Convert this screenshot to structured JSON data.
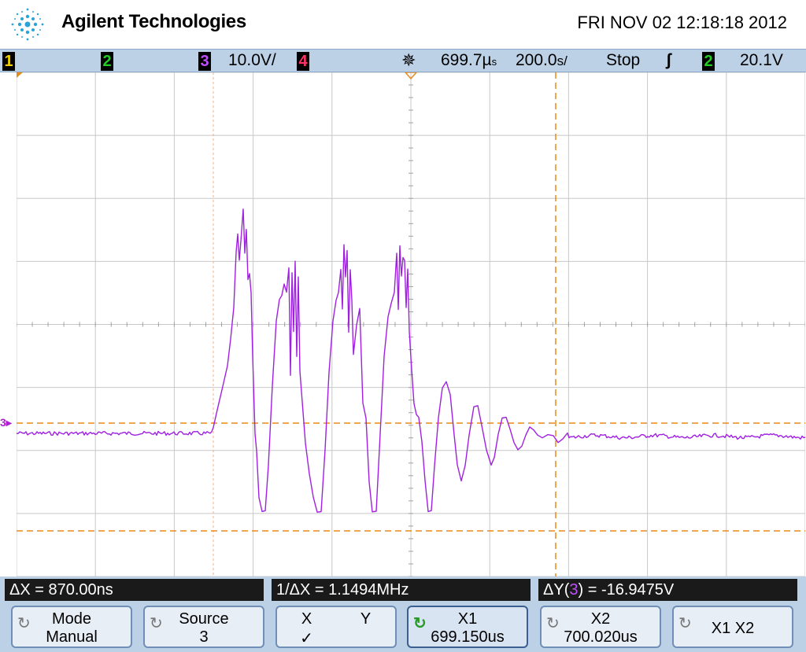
{
  "header": {
    "brand": "Agilent Technologies",
    "datetime": "FRI NOV 02 12:18:18 2012"
  },
  "statusbar": {
    "ch1": "1",
    "ch2": "2",
    "ch3": "3",
    "ch3_scale": "10.0V/",
    "ch4": "4",
    "trigger_icon": "trigger-icon",
    "delay": "699.7µ",
    "delay_unit": "s",
    "timebase": "200.0",
    "timebase_unit": "s/",
    "run_state": "Stop",
    "trigger_edge": "ʃ",
    "trigger_source": "2",
    "trigger_level": "20.1V"
  },
  "screen": {
    "ch3_marker": "3"
  },
  "measurements": {
    "dx": "ΔX = 870.00ns",
    "inv_dx": "1/ΔX = 1.1494MHz",
    "dy_prefix": "ΔY(",
    "dy_ch": "3",
    "dy_suffix": ") = -16.9475V"
  },
  "softkeys": {
    "mode_label": "Mode",
    "mode_value": "Manual",
    "source_label": "Source",
    "source_value": "3",
    "xy_x": "X",
    "xy_y": "Y",
    "xy_check": "✓",
    "x1_label": "X1",
    "x1_value": "699.150us",
    "x2_label": "X2",
    "x2_value": "700.020us",
    "x1x2_label": "X1 X2"
  },
  "colors": {
    "ch1": "#f0d000",
    "ch2": "#22cc22",
    "ch3": "#a020e0",
    "ch4": "#ff3366",
    "cursor": "#e88a1a"
  }
}
